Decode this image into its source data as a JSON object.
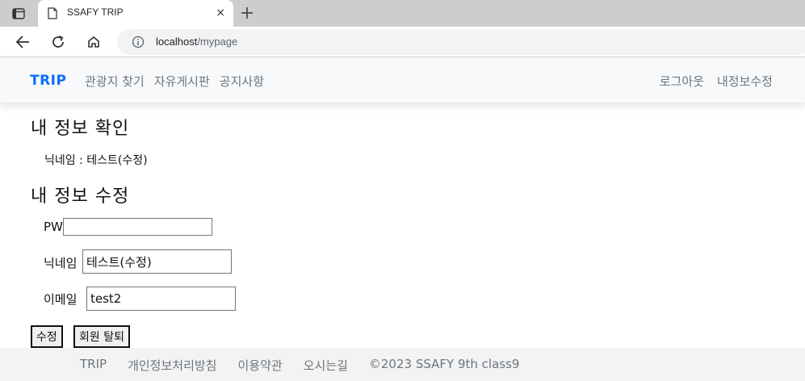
{
  "browser": {
    "tab_title": "SSAFY TRIP",
    "tab_close": "×",
    "url_host": "localhost",
    "url_path": "/mypage"
  },
  "navbar": {
    "brand": "TRIP",
    "left_links": [
      "관광지 찾기",
      "자유게시판",
      "공지사항"
    ],
    "right_links": [
      "로그아웃",
      "내정보수정"
    ]
  },
  "info_section": {
    "heading": "내 정보 확인",
    "nickname_text": "닉네임 : 테스트(수정)"
  },
  "edit_section": {
    "heading": "내 정보 수정",
    "pw_label": "PW",
    "pw_value": "",
    "nickname_label": "닉네임",
    "nickname_value": "테스트(수정)",
    "email_label": "이메일",
    "email_value": "test2",
    "submit_label": "수정",
    "withdraw_label": "회원 탈퇴"
  },
  "footer": {
    "links": [
      "TRIP",
      "개인정보처리방침",
      "이용약관",
      "오시는길"
    ],
    "copyright": "©2023 SSAFY 9th class9"
  }
}
